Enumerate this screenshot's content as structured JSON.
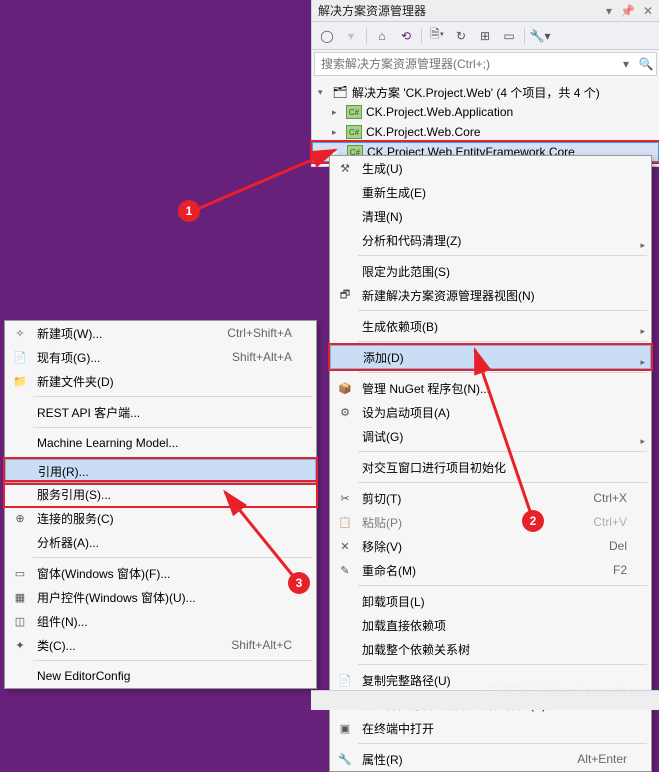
{
  "panel": {
    "title": "解决方案资源管理器",
    "search_placeholder": "搜索解决方案资源管理器(Ctrl+;)"
  },
  "tree": {
    "solution": "解决方案 'CK.Project.Web' (4 个项目，共 4 个)",
    "p1": "CK.Project.Web.Application",
    "p2": "CK.Project.Web.Core",
    "p3": "CK.Project.Web.EntityFramework.Core"
  },
  "rmenu": {
    "build": "生成(U)",
    "rebuild": "重新生成(E)",
    "clean": "清理(N)",
    "analyze": "分析和代码清理(Z)",
    "scope": "限定为此范围(S)",
    "newview": "新建解决方案资源管理器视图(N)",
    "dep": "生成依赖项(B)",
    "add": "添加(D)",
    "nuget": "管理 NuGet 程序包(N)...",
    "startup": "设为启动项目(A)",
    "debug": "调试(G)",
    "interact": "对交互窗口进行项目初始化",
    "cut": "剪切(T)",
    "paste": "粘贴(P)",
    "remove": "移除(V)",
    "rename": "重命名(M)",
    "unload": "卸载项目(L)",
    "direct": "加载直接依赖项",
    "depall": "加载整个依赖关系树",
    "copypath": "复制完整路径(U)",
    "openfolder": "在文件资源管理器中打开文件夹(X)",
    "terminal": "在终端中打开",
    "prop": "属性(R)",
    "sc_cut": "Ctrl+X",
    "sc_paste": "Ctrl+V",
    "sc_del": "Del",
    "sc_f2": "F2",
    "sc_prop": "Alt+Enter"
  },
  "lmenu": {
    "newitem": "新建项(W)...",
    "existing": "现有项(G)...",
    "newfolder": "新建文件夹(D)",
    "rest": "REST API 客户端...",
    "ml": "Machine Learning Model...",
    "ref": "引用(R)...",
    "svc": "服务引用(S)...",
    "connsvc": "连接的服务(C)",
    "analyzer": "分析器(A)...",
    "winform": "窗体(Windows 窗体)(F)...",
    "usercontrol": "用户控件(Windows 窗体)(U)...",
    "component": "组件(N)...",
    "class": "类(C)...",
    "editorconfig": "New EditorConfig",
    "sc_new": "Ctrl+Shift+A",
    "sc_exist": "Shift+Alt+A",
    "sc_class": "Shift+Alt+C"
  },
  "badges": {
    "b1": "1",
    "b2": "2",
    "b3": "3"
  },
  "watermark": "CSDN @jacksonzhao"
}
